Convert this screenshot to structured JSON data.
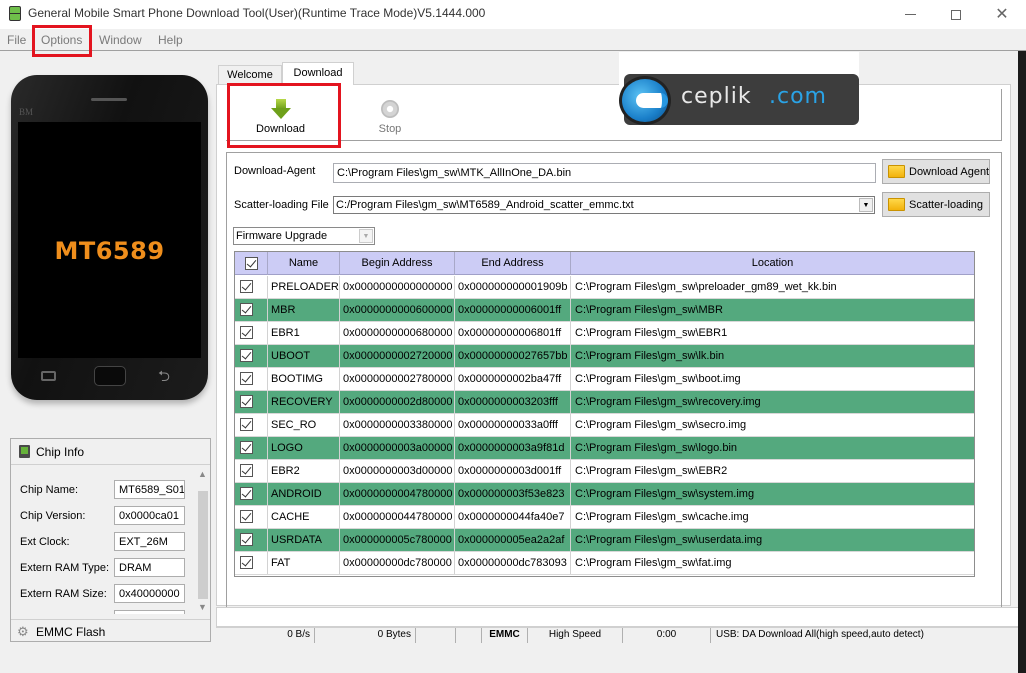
{
  "window": {
    "title": "General Mobile Smart Phone Download Tool(User)(Runtime Trace Mode)V5.1444.000",
    "controls": {
      "minimize": "minimize",
      "maximize": "maximize",
      "close": "✕"
    }
  },
  "menu": {
    "items": [
      "File",
      "Options",
      "Window",
      "Help"
    ]
  },
  "phone": {
    "brand": "BM",
    "chip_model": "MT6589"
  },
  "chip_info": {
    "header": "Chip Info",
    "fields": [
      {
        "label": "Chip Name:",
        "value": "MT6589_S01"
      },
      {
        "label": "Chip Version:",
        "value": "0x0000ca01"
      },
      {
        "label": "Ext Clock:",
        "value": "EXT_26M"
      },
      {
        "label": "Extern RAM Type:",
        "value": "DRAM"
      },
      {
        "label": "Extern RAM Size:",
        "value": "0x40000000"
      }
    ],
    "footer": "EMMC Flash"
  },
  "tabs": [
    {
      "label": "Welcome",
      "active": false
    },
    {
      "label": "Download",
      "active": true
    }
  ],
  "toolbar": {
    "download_label": "Download",
    "stop_label": "Stop"
  },
  "watermark": {
    "text_a": "ceplik",
    "text_b": ".com"
  },
  "form": {
    "download_agent_label": "Download-Agent",
    "download_agent_value": "C:\\Program Files\\gm_sw\\MTK_AllInOne_DA.bin",
    "download_agent_button": "Download Agent",
    "scatter_label": "Scatter-loading File",
    "scatter_value": "C:/Program Files\\gm_sw\\MT6589_Android_scatter_emmc.txt",
    "scatter_button": "Scatter-loading",
    "mode_selected": "Firmware Upgrade"
  },
  "table": {
    "columns": [
      "Name",
      "Begin Address",
      "End Address",
      "Location"
    ],
    "rows": [
      {
        "checked": true,
        "name": "PRELOADER",
        "begin": "0x0000000000000000",
        "end": "0x000000000001909b",
        "location": "C:\\Program Files\\gm_sw\\preloader_gm89_wet_kk.bin"
      },
      {
        "checked": true,
        "name": "MBR",
        "begin": "0x0000000000600000",
        "end": "0x00000000006001ff",
        "location": "C:\\Program Files\\gm_sw\\MBR"
      },
      {
        "checked": true,
        "name": "EBR1",
        "begin": "0x0000000000680000",
        "end": "0x00000000006801ff",
        "location": "C:\\Program Files\\gm_sw\\EBR1"
      },
      {
        "checked": true,
        "name": "UBOOT",
        "begin": "0x0000000002720000",
        "end": "0x00000000027657bb",
        "location": "C:\\Program Files\\gm_sw\\lk.bin"
      },
      {
        "checked": true,
        "name": "BOOTIMG",
        "begin": "0x0000000002780000",
        "end": "0x0000000002ba47ff",
        "location": "C:\\Program Files\\gm_sw\\boot.img"
      },
      {
        "checked": true,
        "name": "RECOVERY",
        "begin": "0x0000000002d80000",
        "end": "0x0000000003203fff",
        "location": "C:\\Program Files\\gm_sw\\recovery.img"
      },
      {
        "checked": true,
        "name": "SEC_RO",
        "begin": "0x0000000003380000",
        "end": "0x00000000033a0fff",
        "location": "C:\\Program Files\\gm_sw\\secro.img"
      },
      {
        "checked": true,
        "name": "LOGO",
        "begin": "0x0000000003a00000",
        "end": "0x0000000003a9f81d",
        "location": "C:\\Program Files\\gm_sw\\logo.bin"
      },
      {
        "checked": true,
        "name": "EBR2",
        "begin": "0x0000000003d00000",
        "end": "0x0000000003d001ff",
        "location": "C:\\Program Files\\gm_sw\\EBR2"
      },
      {
        "checked": true,
        "name": "ANDROID",
        "begin": "0x0000000004780000",
        "end": "0x000000003f53e823",
        "location": "C:\\Program Files\\gm_sw\\system.img"
      },
      {
        "checked": true,
        "name": "CACHE",
        "begin": "0x0000000044780000",
        "end": "0x0000000044fa40e7",
        "location": "C:\\Program Files\\gm_sw\\cache.img"
      },
      {
        "checked": true,
        "name": "USRDATA",
        "begin": "0x000000005c780000",
        "end": "0x000000005ea2a2af",
        "location": "C:\\Program Files\\gm_sw\\userdata.img"
      },
      {
        "checked": true,
        "name": "FAT",
        "begin": "0x00000000dc780000",
        "end": "0x00000000dc783093",
        "location": "C:\\Program Files\\gm_sw\\fat.img"
      }
    ]
  },
  "status": {
    "speed": "0 B/s",
    "bytes": "0 Bytes",
    "storage": "EMMC",
    "mode": "High Speed",
    "time": "0:00",
    "usb": "USB: DA Download All(high speed,auto detect)"
  },
  "colors": {
    "highlight_row": "#54a97e",
    "table_header": "#ccccf5",
    "annotation_red": "#e3141f",
    "chip_text": "#ef8e1c"
  }
}
